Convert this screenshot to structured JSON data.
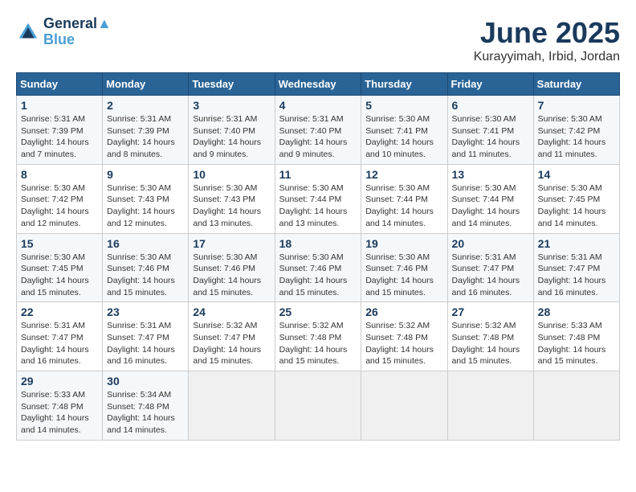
{
  "header": {
    "logo_line1": "General",
    "logo_line2": "Blue",
    "month": "June 2025",
    "location": "Kurayyimah, Irbid, Jordan"
  },
  "weekdays": [
    "Sunday",
    "Monday",
    "Tuesday",
    "Wednesday",
    "Thursday",
    "Friday",
    "Saturday"
  ],
  "weeks": [
    [
      {
        "day": "1",
        "sunrise": "5:31 AM",
        "sunset": "7:39 PM",
        "daylight": "14 hours and 7 minutes."
      },
      {
        "day": "2",
        "sunrise": "5:31 AM",
        "sunset": "7:39 PM",
        "daylight": "14 hours and 8 minutes."
      },
      {
        "day": "3",
        "sunrise": "5:31 AM",
        "sunset": "7:40 PM",
        "daylight": "14 hours and 9 minutes."
      },
      {
        "day": "4",
        "sunrise": "5:31 AM",
        "sunset": "7:40 PM",
        "daylight": "14 hours and 9 minutes."
      },
      {
        "day": "5",
        "sunrise": "5:30 AM",
        "sunset": "7:41 PM",
        "daylight": "14 hours and 10 minutes."
      },
      {
        "day": "6",
        "sunrise": "5:30 AM",
        "sunset": "7:41 PM",
        "daylight": "14 hours and 11 minutes."
      },
      {
        "day": "7",
        "sunrise": "5:30 AM",
        "sunset": "7:42 PM",
        "daylight": "14 hours and 11 minutes."
      }
    ],
    [
      {
        "day": "8",
        "sunrise": "5:30 AM",
        "sunset": "7:42 PM",
        "daylight": "14 hours and 12 minutes."
      },
      {
        "day": "9",
        "sunrise": "5:30 AM",
        "sunset": "7:43 PM",
        "daylight": "14 hours and 12 minutes."
      },
      {
        "day": "10",
        "sunrise": "5:30 AM",
        "sunset": "7:43 PM",
        "daylight": "14 hours and 13 minutes."
      },
      {
        "day": "11",
        "sunrise": "5:30 AM",
        "sunset": "7:44 PM",
        "daylight": "14 hours and 13 minutes."
      },
      {
        "day": "12",
        "sunrise": "5:30 AM",
        "sunset": "7:44 PM",
        "daylight": "14 hours and 14 minutes."
      },
      {
        "day": "13",
        "sunrise": "5:30 AM",
        "sunset": "7:44 PM",
        "daylight": "14 hours and 14 minutes."
      },
      {
        "day": "14",
        "sunrise": "5:30 AM",
        "sunset": "7:45 PM",
        "daylight": "14 hours and 14 minutes."
      }
    ],
    [
      {
        "day": "15",
        "sunrise": "5:30 AM",
        "sunset": "7:45 PM",
        "daylight": "14 hours and 15 minutes."
      },
      {
        "day": "16",
        "sunrise": "5:30 AM",
        "sunset": "7:46 PM",
        "daylight": "14 hours and 15 minutes."
      },
      {
        "day": "17",
        "sunrise": "5:30 AM",
        "sunset": "7:46 PM",
        "daylight": "14 hours and 15 minutes."
      },
      {
        "day": "18",
        "sunrise": "5:30 AM",
        "sunset": "7:46 PM",
        "daylight": "14 hours and 15 minutes."
      },
      {
        "day": "19",
        "sunrise": "5:30 AM",
        "sunset": "7:46 PM",
        "daylight": "14 hours and 15 minutes."
      },
      {
        "day": "20",
        "sunrise": "5:31 AM",
        "sunset": "7:47 PM",
        "daylight": "14 hours and 16 minutes."
      },
      {
        "day": "21",
        "sunrise": "5:31 AM",
        "sunset": "7:47 PM",
        "daylight": "14 hours and 16 minutes."
      }
    ],
    [
      {
        "day": "22",
        "sunrise": "5:31 AM",
        "sunset": "7:47 PM",
        "daylight": "14 hours and 16 minutes."
      },
      {
        "day": "23",
        "sunrise": "5:31 AM",
        "sunset": "7:47 PM",
        "daylight": "14 hours and 16 minutes."
      },
      {
        "day": "24",
        "sunrise": "5:32 AM",
        "sunset": "7:47 PM",
        "daylight": "14 hours and 15 minutes."
      },
      {
        "day": "25",
        "sunrise": "5:32 AM",
        "sunset": "7:48 PM",
        "daylight": "14 hours and 15 minutes."
      },
      {
        "day": "26",
        "sunrise": "5:32 AM",
        "sunset": "7:48 PM",
        "daylight": "14 hours and 15 minutes."
      },
      {
        "day": "27",
        "sunrise": "5:32 AM",
        "sunset": "7:48 PM",
        "daylight": "14 hours and 15 minutes."
      },
      {
        "day": "28",
        "sunrise": "5:33 AM",
        "sunset": "7:48 PM",
        "daylight": "14 hours and 15 minutes."
      }
    ],
    [
      {
        "day": "29",
        "sunrise": "5:33 AM",
        "sunset": "7:48 PM",
        "daylight": "14 hours and 14 minutes."
      },
      {
        "day": "30",
        "sunrise": "5:34 AM",
        "sunset": "7:48 PM",
        "daylight": "14 hours and 14 minutes."
      },
      null,
      null,
      null,
      null,
      null
    ]
  ]
}
